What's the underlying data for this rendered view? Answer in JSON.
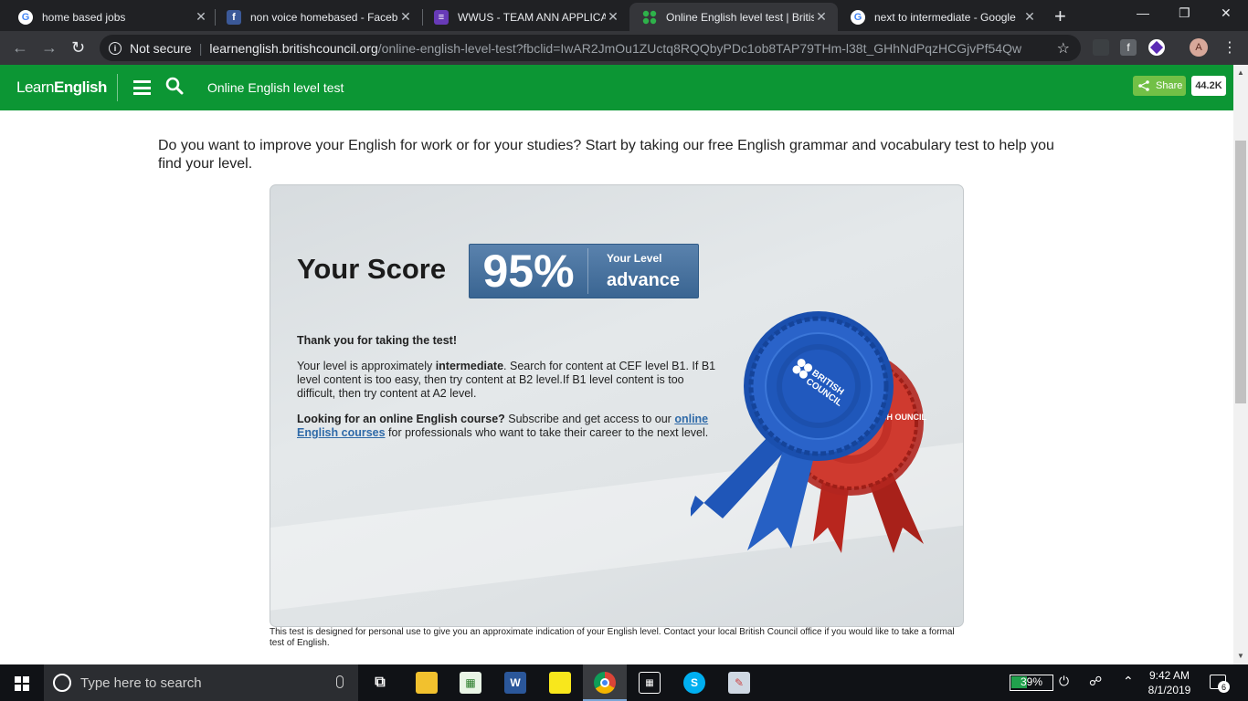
{
  "browser": {
    "tabs": [
      {
        "title": "home based jobs",
        "icon": "google-icon",
        "active": false
      },
      {
        "title": "non voice homebased - Faceb",
        "icon": "facebook-icon",
        "active": false
      },
      {
        "title": "WWUS - TEAM ANN APPLICAT",
        "icon": "forms-icon",
        "active": false
      },
      {
        "title": "Online English level test | Britis",
        "icon": "learnenglish-icon",
        "active": true
      },
      {
        "title": "next to intermediate - Google",
        "icon": "google-icon",
        "active": false
      }
    ],
    "security_label": "Not secure",
    "url_host": "learnenglish.britishcouncil.org",
    "url_path": "/online-english-level-test?fbclid=IwAR2JmOu1ZUctq8RQQbyPDc1ob8TAP79THm-l38t_GHhNdPqzHCGjvPf54Qw",
    "profile_initial": "A"
  },
  "site": {
    "logo_light": "Learn",
    "logo_bold": "English",
    "page_name": "Online English level test",
    "share_label": "Share",
    "share_count": "44.2K"
  },
  "content": {
    "intro": "Do you want to improve your English for work or for your studies? Start by taking our free English grammar and vocabulary test to help you find your level.",
    "score_label": "Your Score",
    "score_value": "95%",
    "level_label": "Your Level",
    "level_value": "advance",
    "thanks": "Thank you for taking the test!",
    "level_text_1": "Your level is approximately ",
    "level_name": "intermediate",
    "level_text_2": ". Search for content at CEF level B1. If B1 level content is too easy, then try content at B2 level.If B1 level content is too difficult, then try content at A2 level.",
    "course_question": "Looking for an online English course?",
    "course_text_1": " Subscribe and get access to our ",
    "course_link": "online English courses",
    "course_text_2": " for professionals who want to take their career to the next level.",
    "rosette_front_text": "BRITISH COUNCIL",
    "rosette_back_text": "ITISH OUNCIL",
    "disclaimer": "This test is designed for personal use to give you an approximate indication of your English level. Contact your local British Council office if you would like to take a formal test of English."
  },
  "taskbar": {
    "search_placeholder": "Type here to search",
    "battery": "39%",
    "battery_fraction": 0.39,
    "time": "9:42 AM",
    "date": "8/1/2019",
    "notifications": "6"
  },
  "colors": {
    "header_green": "#0c9634",
    "score_blue": "#4a74a0",
    "rosette_blue": "#1f55b5",
    "rosette_red": "#c42b22"
  }
}
